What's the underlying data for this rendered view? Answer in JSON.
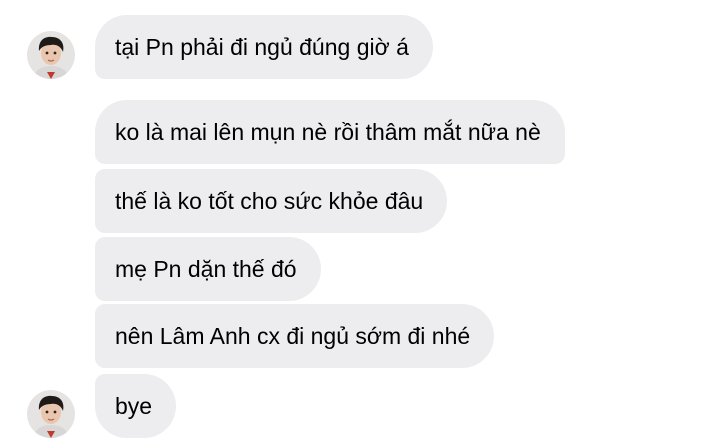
{
  "conversation": {
    "messages": [
      {
        "text": "tại Pn phải đi ngủ đúng giờ á"
      },
      {
        "text": "ko là mai lên mụn nè rồi thâm mắt nữa nè"
      },
      {
        "text": "thế là ko tốt cho sức khỏe đâu"
      },
      {
        "text": "mẹ Pn dặn thế đó"
      },
      {
        "text": "nên Lâm Anh cx đi ngủ sớm đi nhé"
      },
      {
        "text": "bye"
      }
    ],
    "avatar_icon": "contact-avatar",
    "bubble_color": "#ededef"
  }
}
